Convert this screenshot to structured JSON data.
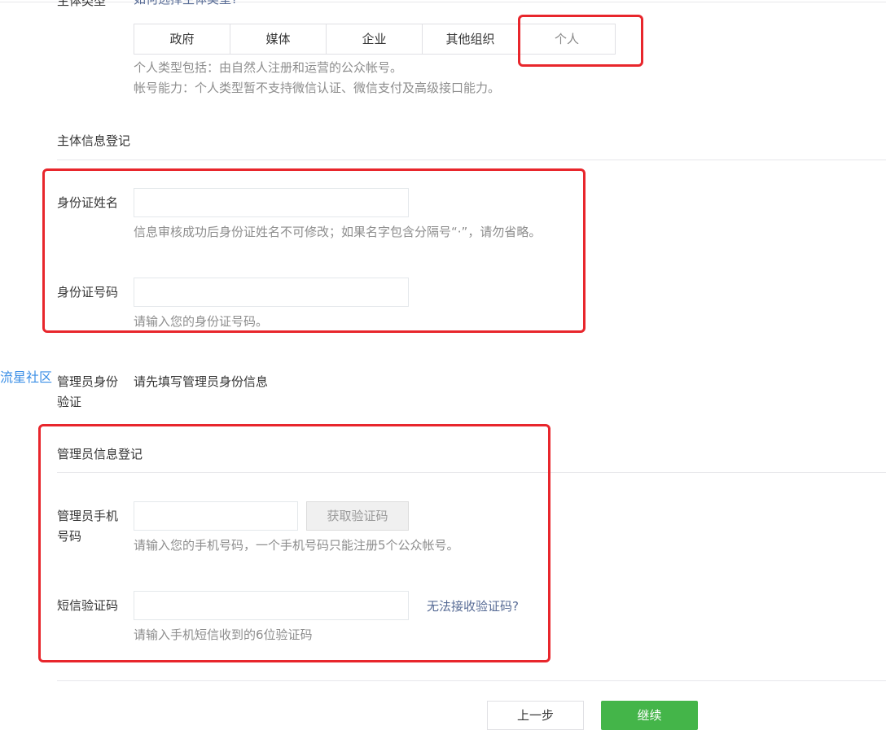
{
  "header": {
    "cut_label": "主体类型",
    "cut_link": "如何选择主体类型?"
  },
  "entity_type": {
    "options": [
      "政府",
      "媒体",
      "企业",
      "其他组织",
      "个人"
    ],
    "selected": "个人",
    "hint1": "个人类型包括：由自然人注册和运营的公众帐号。",
    "hint2": "帐号能力：个人类型暂不支持微信认证、微信支付及高级接口能力。"
  },
  "subject_info": {
    "title": "主体信息登记",
    "id_name_label": "身份证姓名",
    "id_name_value": "",
    "id_name_hint": "信息审核成功后身份证姓名不可修改；如果名字包含分隔号“·”，请勿省略。",
    "id_number_label": "身份证号码",
    "id_number_value": "",
    "id_number_hint": "请输入您的身份证号码。"
  },
  "admin_verify": {
    "label_line1": "管理员身份",
    "label_line2": "验证",
    "text": "请先填写管理员身份信息"
  },
  "admin_info": {
    "title": "管理员信息登记",
    "phone_label_line1": "管理员手机",
    "phone_label_line2": "号码",
    "phone_value": "",
    "get_code_button": "获取验证码",
    "phone_hint": "请输入您的手机号码，一个手机号码只能注册5个公众帐号。",
    "sms_label": "短信验证码",
    "sms_value": "",
    "sms_link": "无法接收验证码?",
    "sms_hint": "请输入手机短信收到的6位验证码"
  },
  "footer": {
    "prev_button": "上一步",
    "next_button": "继续"
  },
  "watermark": "流星社区",
  "colors": {
    "accent_green": "#44b549",
    "link": "#576b95",
    "annotation_red": "#e8262c",
    "hint_gray": "#8d8d8d",
    "watermark_blue": "#3a8ee6"
  }
}
